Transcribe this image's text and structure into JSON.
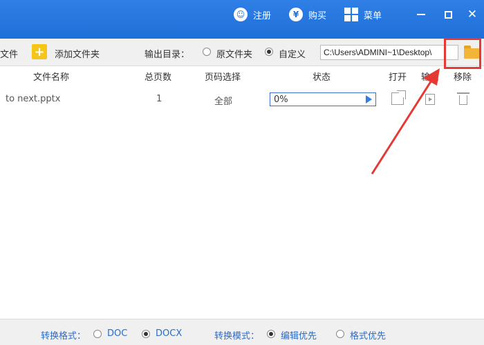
{
  "titlebar": {
    "register_label": "注册",
    "buy_label": "购买",
    "menu_label": "菜单",
    "register_icon_glyph": "☺",
    "buy_icon_glyph": "¥",
    "close_glyph": "✕"
  },
  "toolbar": {
    "add_file_label": "文件",
    "add_folder_label": "添加文件夹",
    "add_folder_icon_glyph": "+",
    "output_dir_label": "输出目录：",
    "option_original": "原文件夹",
    "option_custom": "自定义",
    "selected_option": "自定义",
    "output_path": "C:\\Users\\ADMINI~1\\Desktop\\"
  },
  "table": {
    "headers": {
      "filename": "文件名称",
      "pages": "总页数",
      "page_select": "页码选择",
      "status": "状态",
      "open": "打开",
      "output": "输出",
      "remove": "移除"
    },
    "rows": [
      {
        "filename": "to next.pptx",
        "pages": "1",
        "page_select": "全部",
        "status_text": "0%",
        "progress": 0
      }
    ]
  },
  "footer": {
    "format_label": "转换格式：",
    "format_doc": "DOC",
    "format_docx": "DOCX",
    "selected_format": "DOCX",
    "mode_label": "转换模式：",
    "mode_edit": "编辑优先",
    "mode_format": "格式优先",
    "selected_mode": "编辑优先"
  },
  "colors": {
    "titlebar": "#1f6fd9",
    "accent_text": "#2a6cc9",
    "highlight_red": "#e53935",
    "folder": "#f3b43a"
  },
  "icons": [
    "user-icon",
    "yen-icon",
    "grid-menu-icon",
    "minimize-icon",
    "maximize-icon",
    "close-icon",
    "add-folder-icon",
    "folder-icon",
    "play-icon",
    "open-external-icon",
    "export-icon",
    "trash-icon"
  ]
}
